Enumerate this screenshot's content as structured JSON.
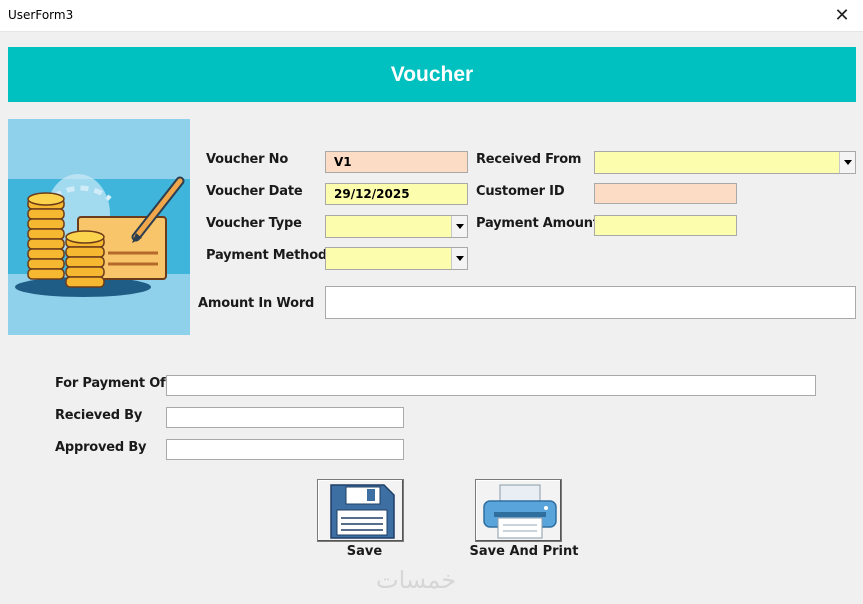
{
  "window": {
    "title": "UserForm3",
    "close_glyph": "✕"
  },
  "header": {
    "title": "Voucher"
  },
  "form": {
    "voucher_no": {
      "label": "Voucher No",
      "value": "V1"
    },
    "voucher_date": {
      "label": "Voucher Date",
      "value": "29/12/2025"
    },
    "voucher_type": {
      "label": "Voucher Type",
      "value": ""
    },
    "payment_method": {
      "label": "Payment Method",
      "value": ""
    },
    "received_from": {
      "label": "Received From",
      "value": ""
    },
    "customer_id": {
      "label": "Customer ID",
      "value": ""
    },
    "payment_amount": {
      "label": "Payment Amount",
      "value": ""
    },
    "amount_in_word": {
      "label": "Amount In Word",
      "value": ""
    },
    "for_payment_of": {
      "label": "For Payment Of",
      "value": ""
    },
    "recieved_by": {
      "label": "Recieved By",
      "value": ""
    },
    "approved_by": {
      "label": "Approved By",
      "value": ""
    }
  },
  "buttons": {
    "save": {
      "label": "Save",
      "icon": "floppy-disk-icon"
    },
    "save_print": {
      "label": "Save And Print",
      "icon": "printer-icon"
    }
  },
  "illustration": {
    "icon": "coins-cheque-pen-icon"
  },
  "watermark": {
    "text": "خمسات"
  },
  "colors": {
    "header": "#00c0c0",
    "peach_field": "#fcdcc4",
    "yellow_field": "#fdfdae",
    "illustration_bg": "#8fd0ea"
  }
}
